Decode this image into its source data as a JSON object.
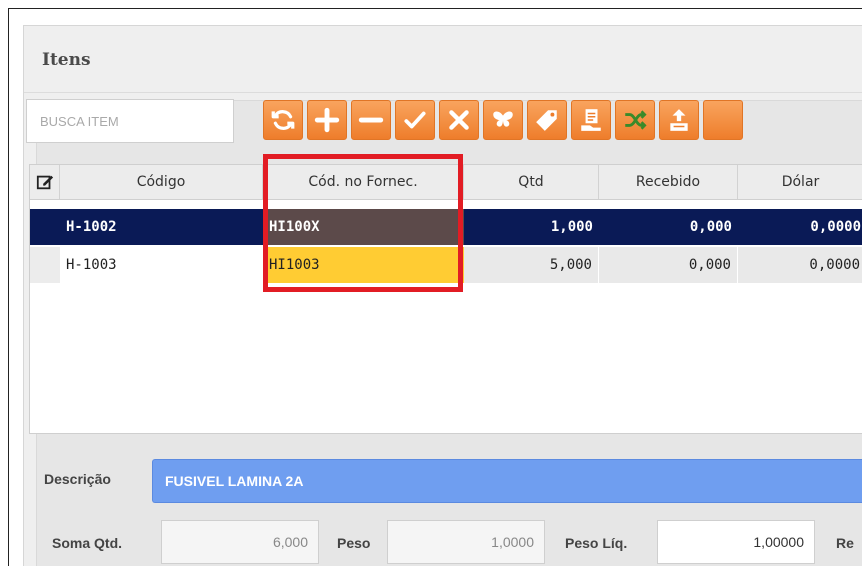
{
  "panel": {
    "title": "Itens"
  },
  "search": {
    "placeholder": "BUSCA ITEM"
  },
  "toolbar": {
    "buttons": [
      {
        "icon": "refresh-icon"
      },
      {
        "icon": "plus-icon"
      },
      {
        "icon": "minus-icon"
      },
      {
        "icon": "check-icon"
      },
      {
        "icon": "close-icon"
      },
      {
        "icon": "butterfly-icon"
      },
      {
        "icon": "tag-icon"
      },
      {
        "icon": "receipt-hand-icon"
      },
      {
        "icon": "shuffle-icon"
      },
      {
        "icon": "upload-box-icon"
      }
    ]
  },
  "grid": {
    "columns": [
      "Código",
      "Cód. no Fornec.",
      "Qtd",
      "Recebido",
      "Dólar"
    ],
    "rows": [
      {
        "codigo": "H-1002",
        "fornec": "HI100X",
        "qtd": "1,000",
        "recebido": "0,000",
        "dolar": "0,0000"
      },
      {
        "codigo": "H-1003",
        "fornec": "HI1003",
        "qtd": "5,000",
        "recebido": "0,000",
        "dolar": "0,0000"
      }
    ]
  },
  "descricao": {
    "label": "Descrição",
    "value": "FUSIVEL LAMINA 2A"
  },
  "footer": {
    "soma_qtd_label": "Soma Qtd.",
    "soma_qtd_value": "6,000",
    "peso_label": "Peso",
    "peso_value": "1,0000",
    "peso_liq_label": "Peso Líq.",
    "peso_liq_value": "1,00000",
    "next_label_partial": "Re"
  },
  "colors": {
    "toolbar_orange": "#f08a36",
    "selected_row": "#0a1a56",
    "selected_cell": "#5c4a4a",
    "edited_cell": "#ffcc33",
    "highlight_border": "#e21c24",
    "description_bg": "#6f9ef0"
  }
}
